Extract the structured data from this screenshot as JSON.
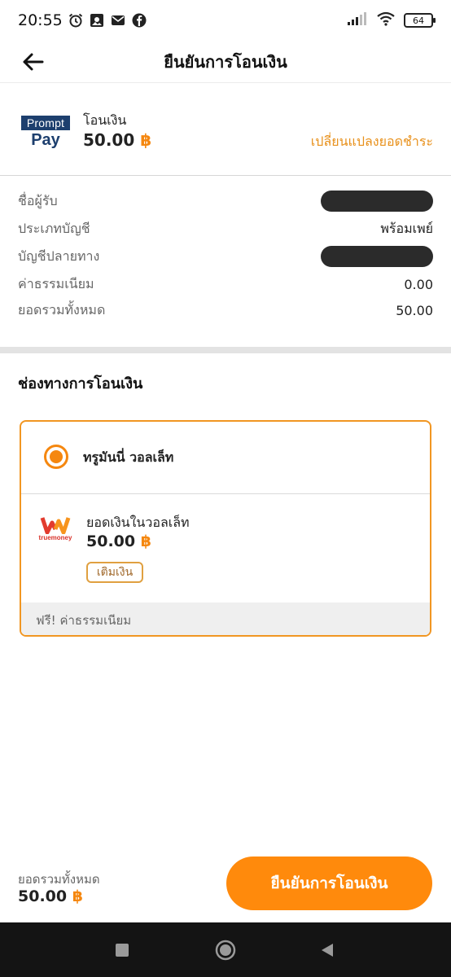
{
  "status_bar": {
    "time": "20:55",
    "battery": "64",
    "icons": [
      "alarm-icon",
      "photo-icon",
      "mail-icon",
      "facebook-icon",
      "signal-icon",
      "wifi-icon",
      "battery-icon"
    ]
  },
  "header": {
    "title": "ยืนยันการโอนเงิน",
    "back_icon": "back-arrow-icon"
  },
  "transfer": {
    "logo_top": "Prompt",
    "logo_bottom": "Pay",
    "label": "โอนเงิน",
    "amount": "50.00",
    "currency_symbol": "฿",
    "change_link": "เปลี่ยนแปลงยอดชำระ"
  },
  "details": {
    "recipient_label": "ชื่อผู้รับ",
    "account_type_label": "ประเภทบัญชี",
    "account_type_value": "พร้อมเพย์",
    "destination_label": "บัญชีปลายทาง",
    "fee_label": "ค่าธรรมเนียม",
    "fee_value": "0.00",
    "total_label": "ยอดรวมทั้งหมด",
    "total_value": "50.00"
  },
  "channel": {
    "title": "ช่องทางการโอนเงิน",
    "wallet_name": "ทรูมันนี่ วอลเล็ท",
    "logo_text": "truemoney",
    "balance_label": "ยอดเงินในวอลเล็ท",
    "balance_value": "50.00",
    "topup_label": "เติมเงิน",
    "free_fee_text": "ฟรี! ค่าธรรมเนียม"
  },
  "footer": {
    "total_label": "ยอดรวมทั้งหมด",
    "total_value": "50.00",
    "confirm_label": "ยืนยันการโอนเงิน"
  },
  "colors": {
    "accent": "#ff8a0c",
    "link": "#e8901a",
    "promptpay_blue": "#1d3f6e",
    "nav_bar": "#141414"
  }
}
